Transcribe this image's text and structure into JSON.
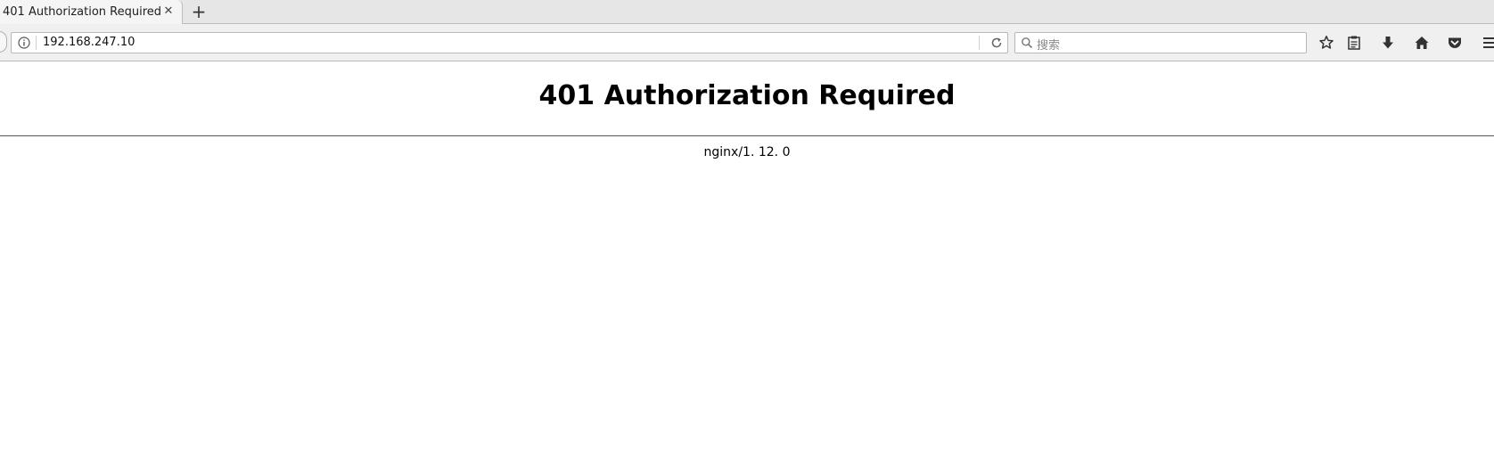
{
  "browser": {
    "tab": {
      "title": "401 Authorization Required",
      "close_label": "✕"
    },
    "new_tab_label": "+",
    "url": "192.168.247.10",
    "search": {
      "placeholder": "搜索"
    }
  },
  "page": {
    "heading": "401 Authorization Required",
    "server": "nginx/1. 12. 0"
  },
  "icons": {
    "info": "info-icon",
    "reload": "reload-icon",
    "search": "search-icon",
    "bookmark": "star-icon",
    "library": "clipboard-icon",
    "downloads": "download-arrow-icon",
    "home": "home-icon",
    "pocket": "pocket-icon",
    "menu": "hamburger-menu-icon"
  }
}
